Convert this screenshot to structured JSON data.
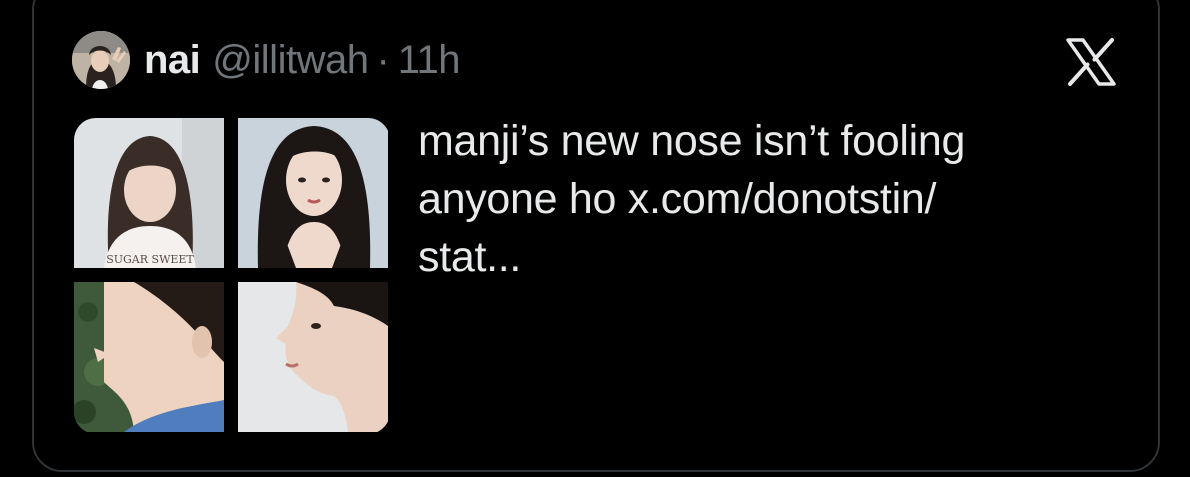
{
  "tweet": {
    "author": {
      "name": "nai",
      "handle": "@illitwah",
      "separator": "·",
      "time": "11h",
      "avatar_icon": "profile-photo"
    },
    "text": "manji’s new nose isn’t fooling\nanyone ho x.com/donotstin/\nstat...",
    "media": {
      "tiles": [
        {
          "label": "photo-top-left",
          "shirt_text": "SUGAR SWEET"
        },
        {
          "label": "photo-top-right"
        },
        {
          "label": "photo-bottom-left"
        },
        {
          "label": "photo-bottom-right"
        }
      ]
    },
    "brand_icon": "x-logo-icon"
  },
  "colors": {
    "background": "#000000",
    "border": "#2f3336",
    "primary_text": "#e7e9ea",
    "secondary_text": "#71767b"
  }
}
